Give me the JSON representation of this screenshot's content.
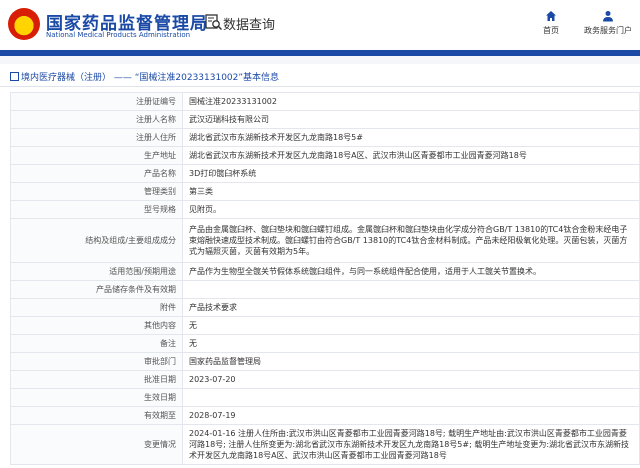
{
  "header": {
    "title": "国家药品监督管理局",
    "subtitle": "National Medical Products Administration",
    "data_query": "数据查询",
    "nav": {
      "home": "首页",
      "portal": "政务服务门户"
    },
    "colors": {
      "brand_blue": "#1b4aa6",
      "logo_red": "#d81e06",
      "logo_gold": "#ffd400"
    }
  },
  "breadcrumb": "境内医疗器械（注册） —— “国械注准20233131002”基本信息",
  "rows": [
    {
      "key": "注册证编号",
      "value": "国械注准20233131002"
    },
    {
      "key": "注册人名称",
      "value": "武汉迈瑞科技有限公司"
    },
    {
      "key": "注册人住所",
      "value": "湖北省武汉市东湖新技术开发区九龙南路18号5#"
    },
    {
      "key": "生产地址",
      "value": "湖北省武汉市东湖新技术开发区九龙南路18号A区、武汉市洪山区青菱都市工业园青菱河路18号"
    },
    {
      "key": "产品名称",
      "value": "3D打印髋臼杯系统"
    },
    {
      "key": "管理类别",
      "value": "第三类"
    },
    {
      "key": "型号规格",
      "value": "见附页。"
    },
    {
      "key": "结构及组成/主要组成成分",
      "value": "产品由金属髋臼杯、髋臼垫块和髋臼螺钉组成。金属髋臼杯和髋臼垫块由化学成分符合GB/T 13810的TC4钛合金粉末经电子束熔融快速成型技术制成。髋臼螺钉由符合GB/T 13810的TC4钛合金材料制成。产品未经阳极氧化处理。灭菌包装，灭菌方式为辐照灭菌，灭菌有效期为5年。"
    },
    {
      "key": "适用范围/预期用途",
      "value": "产品作为生物型全髋关节假体系统髋臼组件，与同一系统组件配合使用，适用于人工髋关节置换术。"
    },
    {
      "key": "产品储存条件及有效期",
      "value": ""
    },
    {
      "key": "附件",
      "value": "产品技术要求"
    },
    {
      "key": "其他内容",
      "value": "无"
    },
    {
      "key": "备注",
      "value": "无"
    },
    {
      "key": "审批部门",
      "value": "国家药品监督管理局"
    },
    {
      "key": "批准日期",
      "value": "2023-07-20"
    },
    {
      "key": "生效日期",
      "value": ""
    },
    {
      "key": "有效期至",
      "value": "2028-07-19"
    },
    {
      "key": "变更情况",
      "value": "2024-01-16 注册人住所由:武汉市洪山区青菱都市工业园青菱河路18号; 载明生产地址由:武汉市洪山区青菱都市工业园青菱河路18号; 注册人住所变更为:湖北省武汉市东湖新技术开发区九龙南路18号5#; 载明生产地址变更为:湖北省武汉市东湖新技术开发区九龙南路18号A区、武汉市洪山区青菱都市工业园青菱河路18号"
    }
  ]
}
